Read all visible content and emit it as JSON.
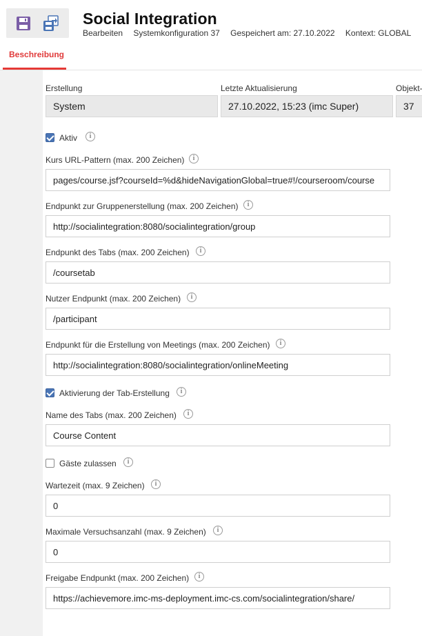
{
  "header": {
    "title": "Social Integration",
    "meta": {
      "mode": "Bearbeiten",
      "config": "Systemkonfiguration 37",
      "saved": "Gespeichert am: 27.10.2022",
      "context": "Kontext: GLOBAL"
    },
    "toolbar": {
      "save_icon": "save-icon",
      "save_as_icon": "save-as-icon"
    }
  },
  "tabs": [
    {
      "label": "Beschreibung",
      "active": true
    }
  ],
  "colors": {
    "accent": "#e53935",
    "checkbox": "#4a75b5",
    "save_icon": "#7b5ea7"
  },
  "readonly": {
    "created_label": "Erstellung",
    "created_value": "System",
    "updated_label": "Letzte Aktualisierung",
    "updated_value": "27.10.2022, 15:23 (imc Super)",
    "object_label": "Objekt-",
    "object_value": "37"
  },
  "fields": {
    "active": {
      "label": "Aktiv",
      "checked": true
    },
    "course_url": {
      "label": "Kurs URL-Pattern (max. 200 Zeichen)",
      "value": "pages/course.jsf?courseId=%d&hideNavigationGlobal=true#!/courseroom/course"
    },
    "group_endpoint": {
      "label": "Endpunkt zur Gruppenerstellung (max. 200 Zeichen)",
      "value": "http://socialintegration:8080/socialintegration/group"
    },
    "tab_endpoint": {
      "label": "Endpunkt des Tabs (max. 200 Zeichen)",
      "value": "/coursetab"
    },
    "user_endpoint": {
      "label": "Nutzer Endpunkt (max. 200 Zeichen)",
      "value": "/participant"
    },
    "meeting_endpoint": {
      "label": "Endpunkt für die Erstellung von Meetings (max. 200 Zeichen)",
      "value": "http://socialintegration:8080/socialintegration/onlineMeeting"
    },
    "tab_creation": {
      "label": "Aktivierung der Tab-Erstellung",
      "checked": true
    },
    "tab_name": {
      "label": "Name des Tabs (max. 200 Zeichen)",
      "value": "Course Content"
    },
    "guests": {
      "label": "Gäste zulassen",
      "checked": false
    },
    "wait_time": {
      "label": "Wartezeit (max. 9 Zeichen)",
      "value": "0"
    },
    "max_attempts": {
      "label": "Maximale Versuchsanzahl (max. 9 Zeichen)",
      "value": "0"
    },
    "share_endpoint": {
      "label": "Freigabe Endpunkt (max. 200 Zeichen)",
      "value": "https://achievemore.imc-ms-deployment.imc-cs.com/socialintegration/share/"
    }
  }
}
